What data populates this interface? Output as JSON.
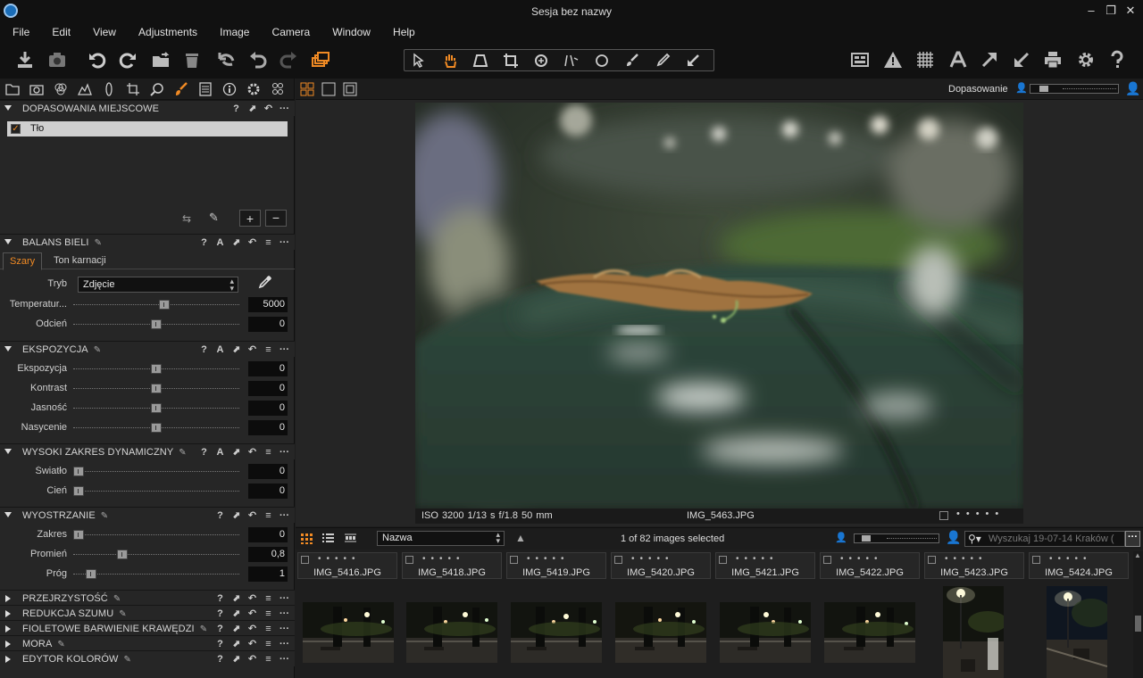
{
  "window": {
    "title": "Sesja bez nazwy"
  },
  "menu": [
    "File",
    "Edit",
    "View",
    "Adjustments",
    "Image",
    "Camera",
    "Window",
    "Help"
  ],
  "viewer": {
    "fit_label": "Dopasowanie",
    "caption_exif": "ISO 3200  1/13 s  f/1.8  50 mm",
    "caption_filename": "IMG_5463.JPG"
  },
  "local_adjustments": {
    "title": "DOPASOWANIA MIEJSCOWE",
    "layer_name": "Tło"
  },
  "white_balance": {
    "title": "BALANS BIELI",
    "tabs": [
      "Szary",
      "Ton karnacji"
    ],
    "mode_label": "Tryb",
    "mode_value": "Zdjęcie",
    "rows": [
      {
        "label": "Temperatur...",
        "value": "5000",
        "pos": 0.55
      },
      {
        "label": "Odcień",
        "value": "0",
        "pos": 0.5
      }
    ]
  },
  "exposure": {
    "title": "EKSPOZYCJA",
    "rows": [
      {
        "label": "Ekspozycja",
        "value": "0",
        "pos": 0.5
      },
      {
        "label": "Kontrast",
        "value": "0",
        "pos": 0.5
      },
      {
        "label": "Jasność",
        "value": "0",
        "pos": 0.5
      },
      {
        "label": "Nasycenie",
        "value": "0",
        "pos": 0.5
      }
    ]
  },
  "hdr": {
    "title": "WYSOKI ZAKRES DYNAMICZNY",
    "rows": [
      {
        "label": "Światło",
        "value": "0",
        "pos": 0.0
      },
      {
        "label": "Cień",
        "value": "0",
        "pos": 0.0
      }
    ]
  },
  "sharpening": {
    "title": "WYOSTRZANIE",
    "rows": [
      {
        "label": "Zakres",
        "value": "0",
        "pos": 0.0
      },
      {
        "label": "Promień",
        "value": "0,8",
        "pos": 0.28
      },
      {
        "label": "Próg",
        "value": "1",
        "pos": 0.08
      }
    ]
  },
  "collapsed_sections": [
    "PRZEJRZYSTOŚĆ",
    "REDUKCJA SZUMU",
    "FIOLETOWE BARWIENIE KRAWĘDZI",
    "MORA",
    "EDYTOR KOLORÓW"
  ],
  "browser": {
    "sort_value": "Nazwa",
    "selection_status": "1 of 82 images selected",
    "search_placeholder": "Wyszukaj 19-07-14 Kraków (",
    "thumbnails": [
      {
        "name": "IMG_5416.JPG",
        "orientation": "landscape"
      },
      {
        "name": "IMG_5418.JPG",
        "orientation": "landscape"
      },
      {
        "name": "IMG_5419.JPG",
        "orientation": "landscape"
      },
      {
        "name": "IMG_5420.JPG",
        "orientation": "landscape"
      },
      {
        "name": "IMG_5421.JPG",
        "orientation": "landscape"
      },
      {
        "name": "IMG_5422.JPG",
        "orientation": "landscape"
      },
      {
        "name": "IMG_5423.JPG",
        "orientation": "portrait"
      },
      {
        "name": "IMG_5424.JPG",
        "orientation": "portrait"
      }
    ]
  },
  "colors": {
    "accent": "#f08a24",
    "panel": "#262626",
    "field": "#0c0c0c"
  }
}
